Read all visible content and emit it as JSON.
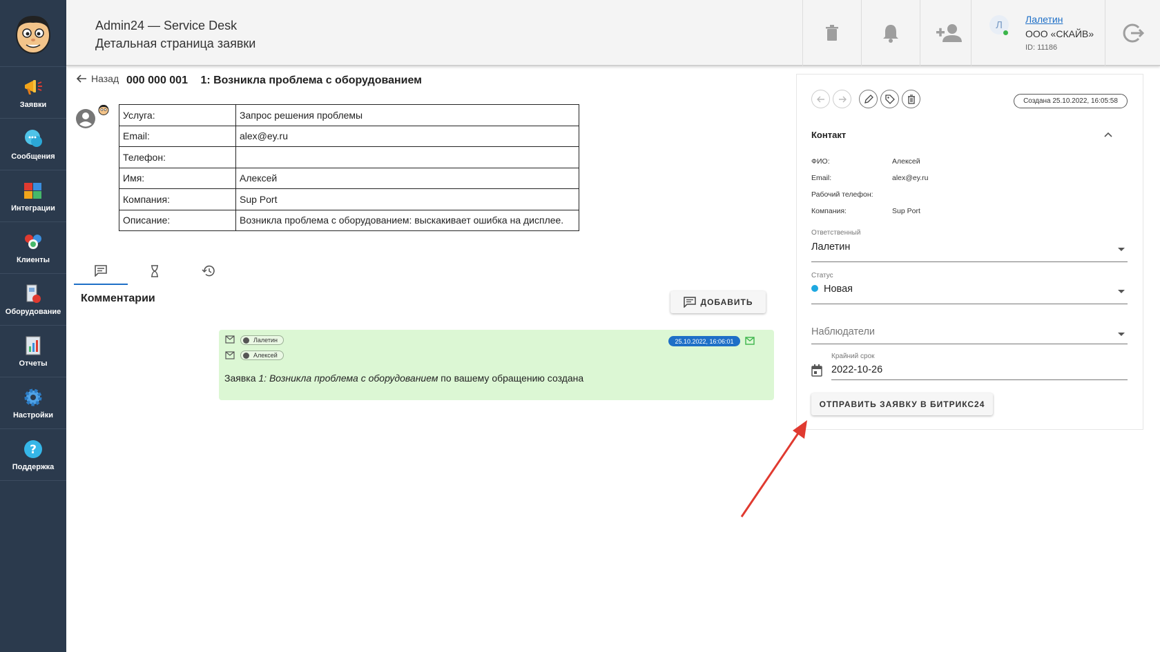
{
  "header": {
    "app_title": "Admin24 — Service Desk",
    "page_subtitle": "Детальная страница заявки"
  },
  "user": {
    "initial": "Л",
    "name": "Лалетин",
    "company": "ООО «СКАЙВ»",
    "id": "ID: 11186"
  },
  "sidebar": {
    "items": [
      {
        "label": "Заявки",
        "icon": "megaphone-icon"
      },
      {
        "label": "Сообщения",
        "icon": "chat-bubbles-icon"
      },
      {
        "label": "Интеграции",
        "icon": "puzzle-icon"
      },
      {
        "label": "Клиенты",
        "icon": "people-icon"
      },
      {
        "label": "Оборудование",
        "icon": "printer-icon"
      },
      {
        "label": "Отчеты",
        "icon": "report-chart-icon"
      },
      {
        "label": "Настройки",
        "icon": "gear-icon"
      },
      {
        "label": "Поддержка",
        "icon": "help-icon"
      }
    ]
  },
  "ticket": {
    "back_label": "Назад",
    "number": "000 000 001",
    "title": "1: Возникла проблема с оборудованием",
    "fields": [
      {
        "key": "Услуга:",
        "value": "Запрос решения проблемы"
      },
      {
        "key": "Email:",
        "value": "alex@ey.ru"
      },
      {
        "key": "Телефон:",
        "value": ""
      },
      {
        "key": "Имя:",
        "value": "Алексей"
      },
      {
        "key": "Компания:",
        "value": "Sup Port"
      },
      {
        "key": "Описание:",
        "value": "Возникла проблема с оборудованием: выскакивает ошибка на дисплее."
      }
    ]
  },
  "comments": {
    "title": "Комментарии",
    "add_label": "ДОБАВИТЬ",
    "items": [
      {
        "from": "Лалетин",
        "to": "Алексей",
        "date": "25.10.2022, 16:06:01",
        "text_before": "Заявка ",
        "text_italic": "1: Возникла проблема с оборудованием",
        "text_after": " по вашему обращению создана"
      }
    ]
  },
  "panel": {
    "created": "Создана 25.10.2022, 16:05:58",
    "contact_title": "Контакт",
    "contact": [
      {
        "key": "ФИО:",
        "value": "Алексей"
      },
      {
        "key": "Email:",
        "value": "alex@ey.ru"
      },
      {
        "key": "Рабочий телефон:",
        "value": ""
      },
      {
        "key": "Компания:",
        "value": "Sup Port"
      }
    ],
    "responsible_label": "Ответственный",
    "responsible_value": "Лалетин",
    "status_label": "Статус",
    "status_value": "Новая",
    "status_color": "#1ea8e0",
    "watchers_placeholder": "Наблюдатели",
    "deadline_label": "Крайний срок",
    "deadline_value": "2022-10-26",
    "send_label": "ОТПРАВИТЬ ЗАЯВКУ В БИТРИКС24"
  },
  "colors": {
    "sidebar": "#2b3a4d",
    "accent": "#1e6fc7",
    "comment_bg": "#dcf7d4",
    "annotation_arrow": "#e03a30"
  }
}
